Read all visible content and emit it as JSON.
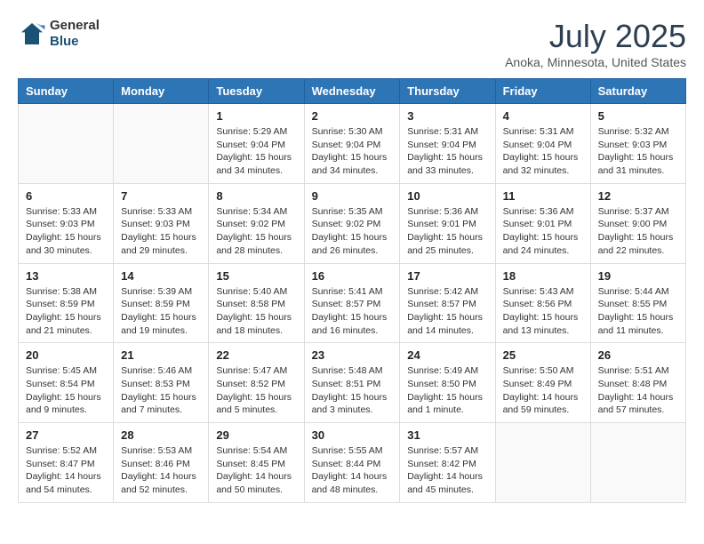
{
  "logo": {
    "general": "General",
    "blue": "Blue"
  },
  "title": "July 2025",
  "subtitle": "Anoka, Minnesota, United States",
  "days_of_week": [
    "Sunday",
    "Monday",
    "Tuesday",
    "Wednesday",
    "Thursday",
    "Friday",
    "Saturday"
  ],
  "weeks": [
    [
      {
        "day": "",
        "info": ""
      },
      {
        "day": "",
        "info": ""
      },
      {
        "day": "1",
        "info": "Sunrise: 5:29 AM\nSunset: 9:04 PM\nDaylight: 15 hours and 34 minutes."
      },
      {
        "day": "2",
        "info": "Sunrise: 5:30 AM\nSunset: 9:04 PM\nDaylight: 15 hours and 34 minutes."
      },
      {
        "day": "3",
        "info": "Sunrise: 5:31 AM\nSunset: 9:04 PM\nDaylight: 15 hours and 33 minutes."
      },
      {
        "day": "4",
        "info": "Sunrise: 5:31 AM\nSunset: 9:04 PM\nDaylight: 15 hours and 32 minutes."
      },
      {
        "day": "5",
        "info": "Sunrise: 5:32 AM\nSunset: 9:03 PM\nDaylight: 15 hours and 31 minutes."
      }
    ],
    [
      {
        "day": "6",
        "info": "Sunrise: 5:33 AM\nSunset: 9:03 PM\nDaylight: 15 hours and 30 minutes."
      },
      {
        "day": "7",
        "info": "Sunrise: 5:33 AM\nSunset: 9:03 PM\nDaylight: 15 hours and 29 minutes."
      },
      {
        "day": "8",
        "info": "Sunrise: 5:34 AM\nSunset: 9:02 PM\nDaylight: 15 hours and 28 minutes."
      },
      {
        "day": "9",
        "info": "Sunrise: 5:35 AM\nSunset: 9:02 PM\nDaylight: 15 hours and 26 minutes."
      },
      {
        "day": "10",
        "info": "Sunrise: 5:36 AM\nSunset: 9:01 PM\nDaylight: 15 hours and 25 minutes."
      },
      {
        "day": "11",
        "info": "Sunrise: 5:36 AM\nSunset: 9:01 PM\nDaylight: 15 hours and 24 minutes."
      },
      {
        "day": "12",
        "info": "Sunrise: 5:37 AM\nSunset: 9:00 PM\nDaylight: 15 hours and 22 minutes."
      }
    ],
    [
      {
        "day": "13",
        "info": "Sunrise: 5:38 AM\nSunset: 8:59 PM\nDaylight: 15 hours and 21 minutes."
      },
      {
        "day": "14",
        "info": "Sunrise: 5:39 AM\nSunset: 8:59 PM\nDaylight: 15 hours and 19 minutes."
      },
      {
        "day": "15",
        "info": "Sunrise: 5:40 AM\nSunset: 8:58 PM\nDaylight: 15 hours and 18 minutes."
      },
      {
        "day": "16",
        "info": "Sunrise: 5:41 AM\nSunset: 8:57 PM\nDaylight: 15 hours and 16 minutes."
      },
      {
        "day": "17",
        "info": "Sunrise: 5:42 AM\nSunset: 8:57 PM\nDaylight: 15 hours and 14 minutes."
      },
      {
        "day": "18",
        "info": "Sunrise: 5:43 AM\nSunset: 8:56 PM\nDaylight: 15 hours and 13 minutes."
      },
      {
        "day": "19",
        "info": "Sunrise: 5:44 AM\nSunset: 8:55 PM\nDaylight: 15 hours and 11 minutes."
      }
    ],
    [
      {
        "day": "20",
        "info": "Sunrise: 5:45 AM\nSunset: 8:54 PM\nDaylight: 15 hours and 9 minutes."
      },
      {
        "day": "21",
        "info": "Sunrise: 5:46 AM\nSunset: 8:53 PM\nDaylight: 15 hours and 7 minutes."
      },
      {
        "day": "22",
        "info": "Sunrise: 5:47 AM\nSunset: 8:52 PM\nDaylight: 15 hours and 5 minutes."
      },
      {
        "day": "23",
        "info": "Sunrise: 5:48 AM\nSunset: 8:51 PM\nDaylight: 15 hours and 3 minutes."
      },
      {
        "day": "24",
        "info": "Sunrise: 5:49 AM\nSunset: 8:50 PM\nDaylight: 15 hours and 1 minute."
      },
      {
        "day": "25",
        "info": "Sunrise: 5:50 AM\nSunset: 8:49 PM\nDaylight: 14 hours and 59 minutes."
      },
      {
        "day": "26",
        "info": "Sunrise: 5:51 AM\nSunset: 8:48 PM\nDaylight: 14 hours and 57 minutes."
      }
    ],
    [
      {
        "day": "27",
        "info": "Sunrise: 5:52 AM\nSunset: 8:47 PM\nDaylight: 14 hours and 54 minutes."
      },
      {
        "day": "28",
        "info": "Sunrise: 5:53 AM\nSunset: 8:46 PM\nDaylight: 14 hours and 52 minutes."
      },
      {
        "day": "29",
        "info": "Sunrise: 5:54 AM\nSunset: 8:45 PM\nDaylight: 14 hours and 50 minutes."
      },
      {
        "day": "30",
        "info": "Sunrise: 5:55 AM\nSunset: 8:44 PM\nDaylight: 14 hours and 48 minutes."
      },
      {
        "day": "31",
        "info": "Sunrise: 5:57 AM\nSunset: 8:42 PM\nDaylight: 14 hours and 45 minutes."
      },
      {
        "day": "",
        "info": ""
      },
      {
        "day": "",
        "info": ""
      }
    ]
  ]
}
